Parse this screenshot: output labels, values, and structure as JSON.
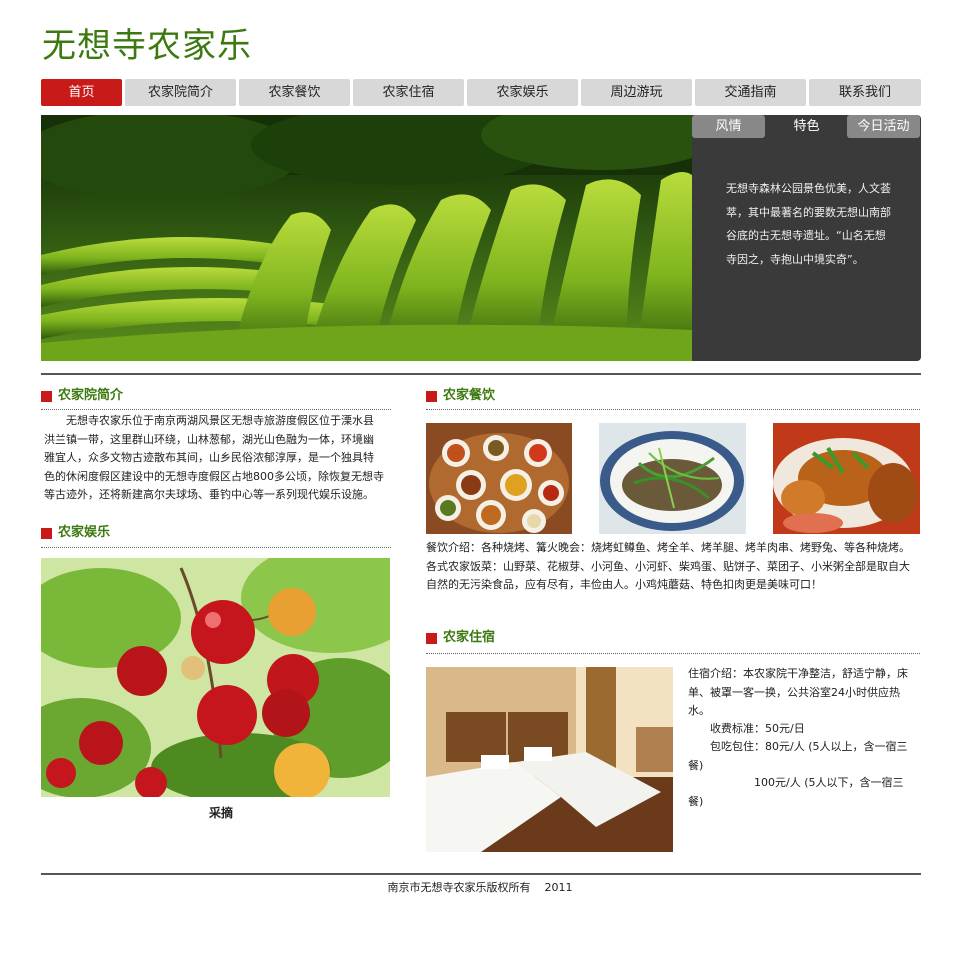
{
  "site": {
    "title": "无想寺农家乐"
  },
  "nav": {
    "items": [
      {
        "label": "首页",
        "active": true
      },
      {
        "label": "农家院简介",
        "active": false
      },
      {
        "label": "农家餐饮",
        "active": false
      },
      {
        "label": "农家住宿",
        "active": false
      },
      {
        "label": "农家娱乐",
        "active": false
      },
      {
        "label": "周边游玩",
        "active": false
      },
      {
        "label": "交通指南",
        "active": false
      },
      {
        "label": "联系我们",
        "active": false
      }
    ]
  },
  "feature": {
    "tabs": [
      "风情",
      "特色",
      "今日活动"
    ],
    "active_tab": "特色",
    "text": "无想寺森林公园景色优美，人文荟萃，其中最著名的要数无想山南部谷底的古无想寺遗址。“山名无想寺因之，寺抱山中境实奇”。"
  },
  "intro": {
    "heading": "农家院简介",
    "text": "无想寺农家乐位于南京两湖风景区无想寺旅游度假区位于溧水县洪兰镇一带，这里群山环绕，山林葱郁，湖光山色融为一体，环境幽雅宜人，众多文物古迹散布其间，山乡民俗浓郁淳厚，是一个独具特色的休闲度假区建设中的无想寺度假区占地800多公顷，除恢复无想寺等古迹外，还将新建高尔夫球场、垂钓中心等一系列现代娱乐设施。"
  },
  "entertainment": {
    "heading": "农家娱乐",
    "caption": "采摘"
  },
  "dining": {
    "heading": "农家餐饮",
    "text": "餐饮介绍：各种烧烤、篝火晚会：烧烤虹鳟鱼、烤全羊、烤羊腿、烤羊肉串、烤野兔、等各种烧烤。各式农家饭菜：山野菜、花椒芽、小河鱼、小河虾、柴鸡蛋、贴饼子、菜团子、小米粥全部是取自大自然的无污染食品，应有尽有，丰俭由人。小鸡炖蘑菇、特色扣肉更是美味可口！"
  },
  "lodging": {
    "heading": "农家住宿",
    "intro": "住宿介绍：本农家院干净整洁，舒适宁静，床单、被罩一客一换，公共浴室24小时供应热水。",
    "fee": "收费标准：50元/日",
    "board1": "包吃包住：80元/人 (5人以上，含一宿三餐)",
    "board2": "100元/人 (5人以下，含一宿三餐)"
  },
  "footer": {
    "text": "南京市无想寺农家乐版权所有    2011"
  },
  "colors": {
    "brand_green": "#3c7a10",
    "accent_red": "#c91a1a",
    "panel_grey": "#3a3a3a",
    "nav_grey": "#d8d8d8"
  }
}
